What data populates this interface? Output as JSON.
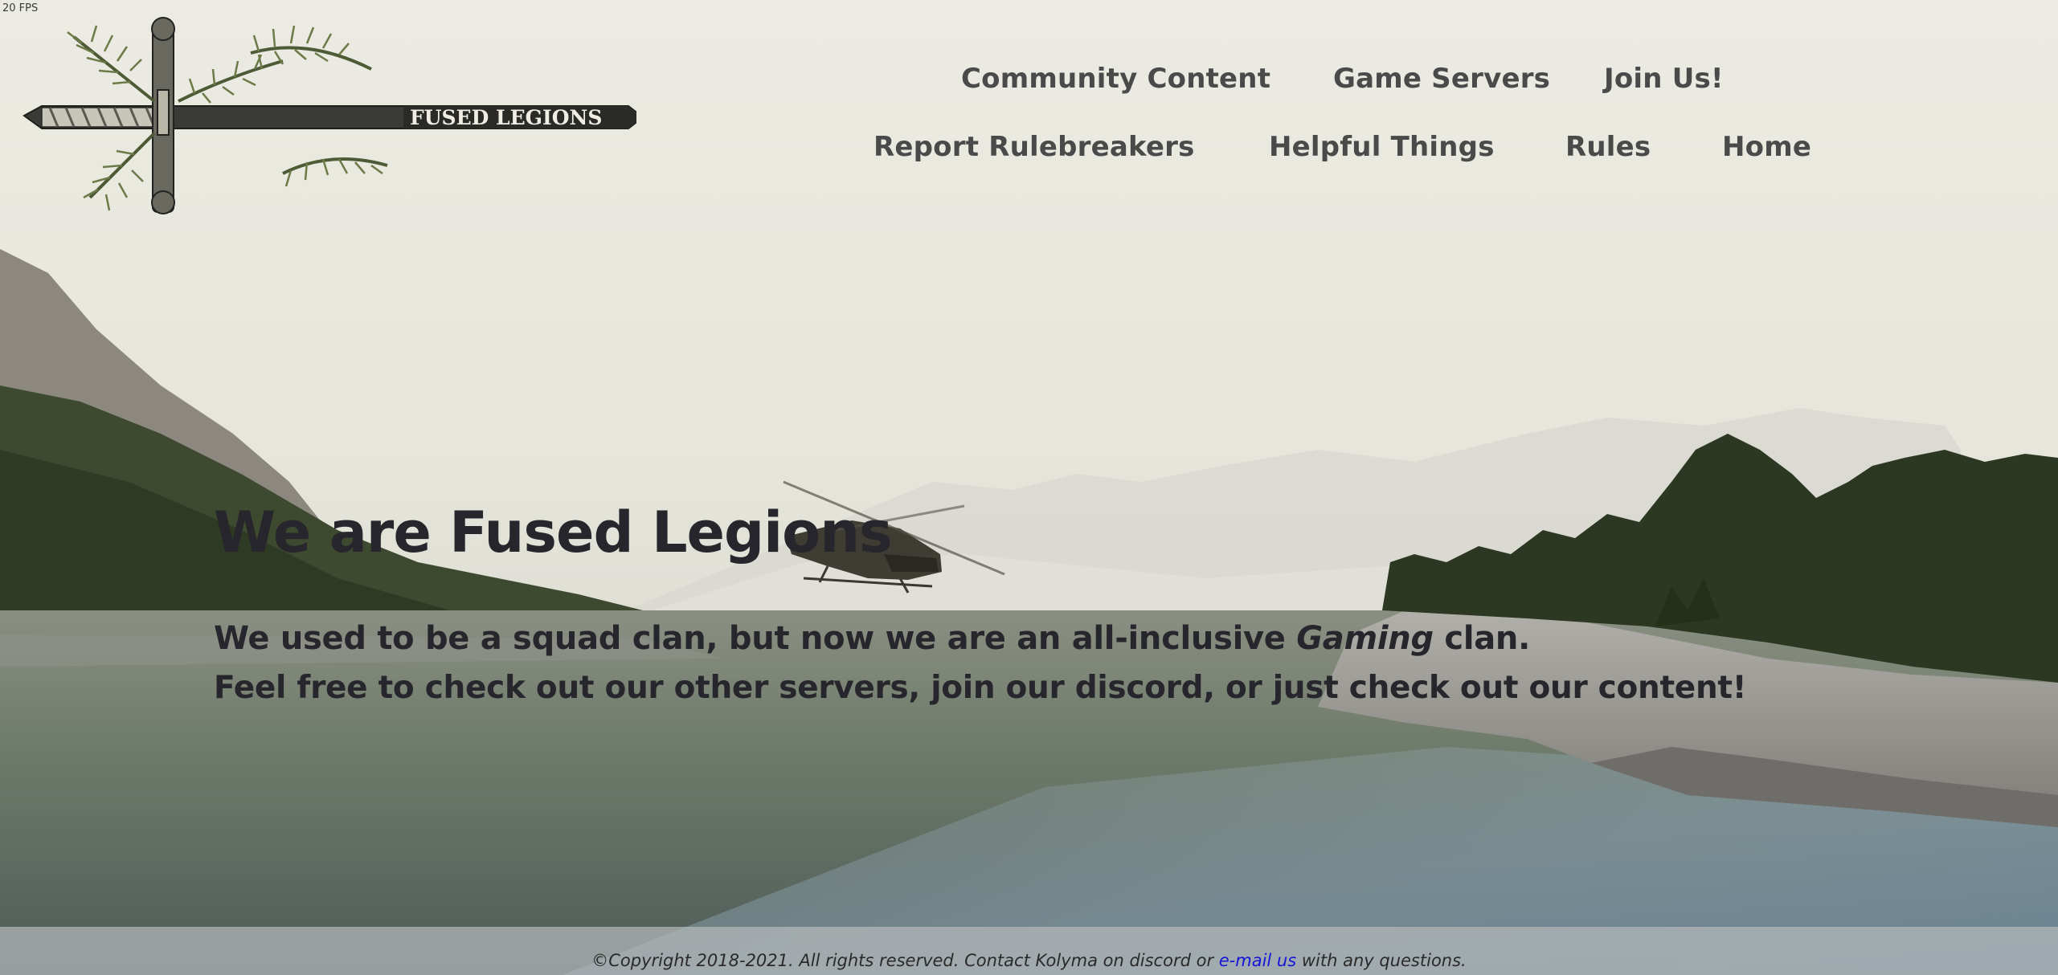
{
  "fps_counter": "20 FPS",
  "logo": {
    "brand_text": "FUSED LEGIONS"
  },
  "nav": {
    "row1": [
      "Community Content",
      "Game Servers",
      "Join Us!"
    ],
    "row2": [
      "Report Rulebreakers",
      "Helpful Things",
      "Rules",
      "Home"
    ]
  },
  "hero": {
    "title": "We are Fused Legions",
    "line1_before": "We used to be a squad clan, but now we are an all-inclusive ",
    "line1_em": "Gaming",
    "line1_after": " clan.",
    "line2": "Feel free to check out our other servers, join our discord, or just check out our content!"
  },
  "footer": {
    "text_before": "©Copyright 2018-2021. All rights reserved. Contact Kolyma on discord or ",
    "link": "e-mail us",
    "text_after": " with any questions."
  },
  "colors": {
    "nav_text": "#4a4a4a",
    "hero_text": "#26262c",
    "footer_link": "#1515d8",
    "footer_bg": "#b4b8ba"
  },
  "icons": [
    "crest-logo-icon",
    "helicopter-icon"
  ]
}
